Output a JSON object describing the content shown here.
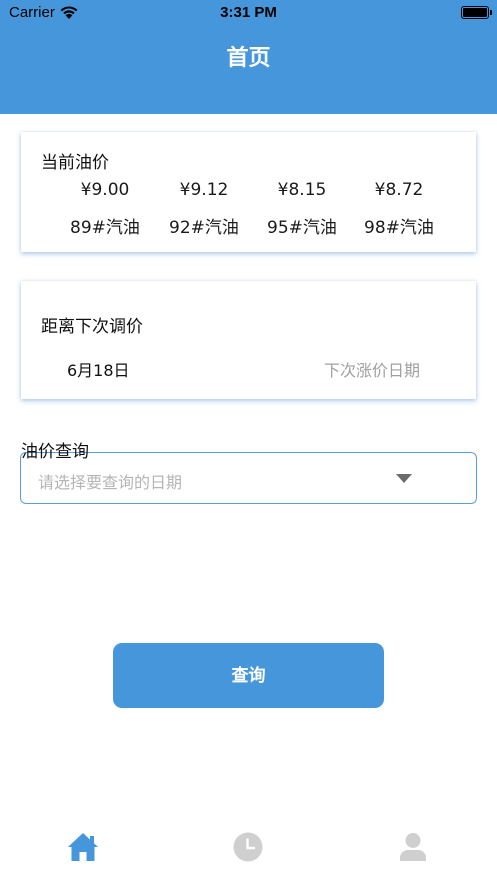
{
  "status_bar": {
    "carrier": "Carrier",
    "time": "3:31 PM"
  },
  "header": {
    "title": "首页"
  },
  "current_price": {
    "title": "当前油价",
    "items": [
      {
        "value": "¥9.00",
        "label": "89#汽油"
      },
      {
        "value": "¥9.12",
        "label": "92#汽油"
      },
      {
        "value": "¥8.15",
        "label": "95#汽油"
      },
      {
        "value": "¥8.72",
        "label": "98#汽油"
      }
    ]
  },
  "next_adjust": {
    "title": "距离下次调价",
    "date": "6月18日",
    "hint": "下次涨价日期"
  },
  "query": {
    "label": "油价查询",
    "placeholder": "请选择要查询的日期",
    "button_label": "查询"
  },
  "tabbar": {
    "items": [
      {
        "icon": "home-icon",
        "active": true
      },
      {
        "icon": "clock-icon",
        "active": false
      },
      {
        "icon": "user-icon",
        "active": false
      }
    ]
  },
  "colors": {
    "accent": "#4596db",
    "inactive": "#cfcfcf",
    "placeholder": "#b5b5b5"
  }
}
